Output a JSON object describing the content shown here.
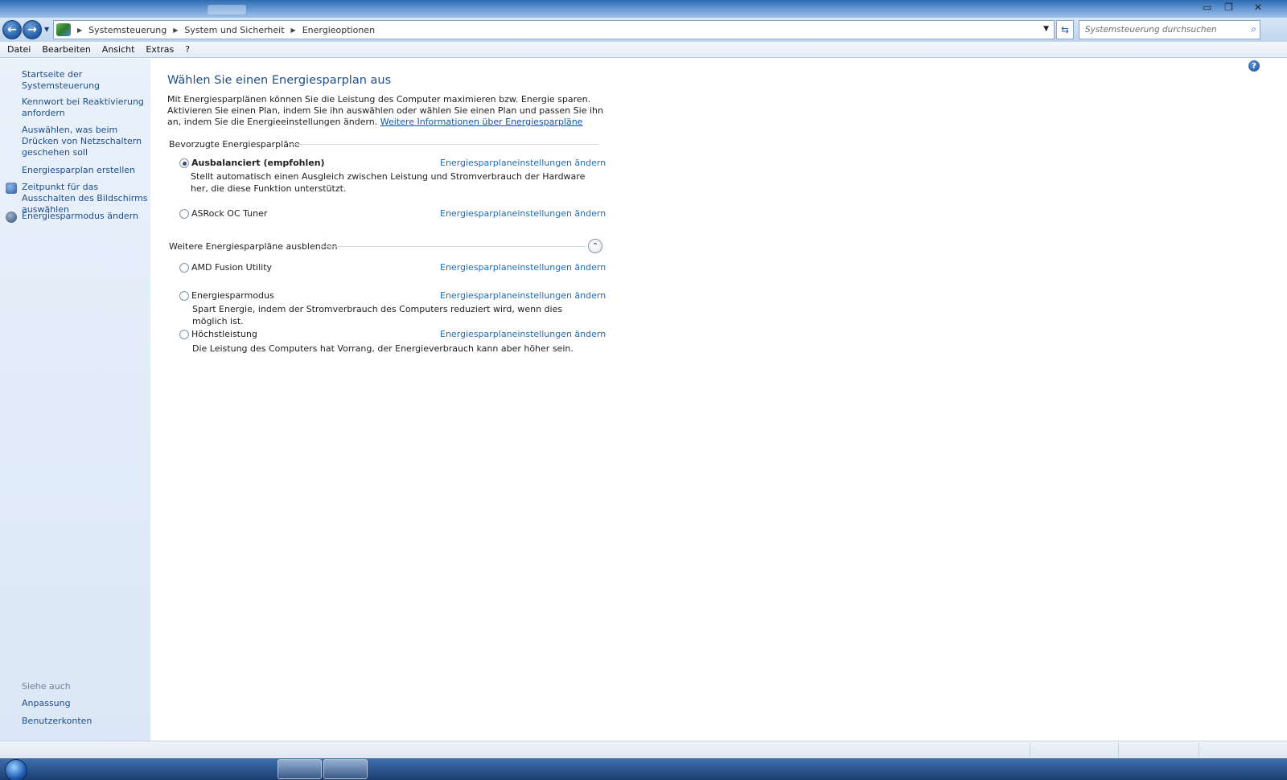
{
  "window": {
    "minimize_glyph": "▭",
    "maximize_glyph": "❐",
    "close_glyph": "✕"
  },
  "address": {
    "back_glyph": "←",
    "forward_glyph": "→",
    "breadcrumb": [
      "Systemsteuerung",
      "System und Sicherheit",
      "Energieoptionen"
    ],
    "search_placeholder": "Systemsteuerung durchsuchen"
  },
  "menu": [
    "Datei",
    "Bearbeiten",
    "Ansicht",
    "Extras",
    "?"
  ],
  "sidebar": {
    "home": "Startseite der Systemsteuerung",
    "links": [
      "Kennwort bei Reaktivierung anfordern",
      "Auswählen, was beim Drücken von Netzschaltern geschehen soll",
      "Energiesparplan erstellen",
      "Zeitpunkt für das Ausschalten des Bildschirms auswählen",
      "Energiesparmodus ändern"
    ],
    "see_also_label": "Siehe auch",
    "see_also": [
      "Anpassung",
      "Benutzerkonten"
    ]
  },
  "main": {
    "title": "Wählen Sie einen Energiesparplan aus",
    "intro": "Mit Energiesparplänen können Sie die Leistung des Computer maximieren bzw. Energie sparen. Aktivieren Sie einen Plan, indem Sie ihn auswählen oder wählen Sie einen Plan und passen Sie ihn an, indem Sie die Energieeinstellungen ändern.",
    "intro_link": "Weitere Informationen über Energiesparpläne",
    "preferred_header": "Bevorzugte Energiesparpläne",
    "more_header": "Weitere Energiesparpläne ausblenden",
    "change_link": "Energiesparplaneinstellungen ändern",
    "plans": [
      {
        "name": "Ausbalanciert (empfohlen)",
        "selected": true,
        "desc": "Stellt automatisch einen Ausgleich zwischen Leistung und Stromverbrauch der Hardware her, die diese Funktion unterstützt."
      },
      {
        "name": "ASRock OC Tuner",
        "selected": false,
        "desc": ""
      },
      {
        "name": "AMD Fusion Utility",
        "selected": false,
        "desc": ""
      },
      {
        "name": "Energiesparmodus",
        "selected": false,
        "desc": "Spart Energie, indem der Stromverbrauch des Computers reduziert wird, wenn dies möglich ist."
      },
      {
        "name": "Höchstleistung",
        "selected": false,
        "desc": "Die Leistung des Computers hat Vorrang, der Energieverbrauch kann aber höher sein."
      }
    ]
  },
  "help_glyph": "?",
  "collapse_glyph": "⌃",
  "refresh_glyph": "⇆",
  "search_glyph": "⌕"
}
